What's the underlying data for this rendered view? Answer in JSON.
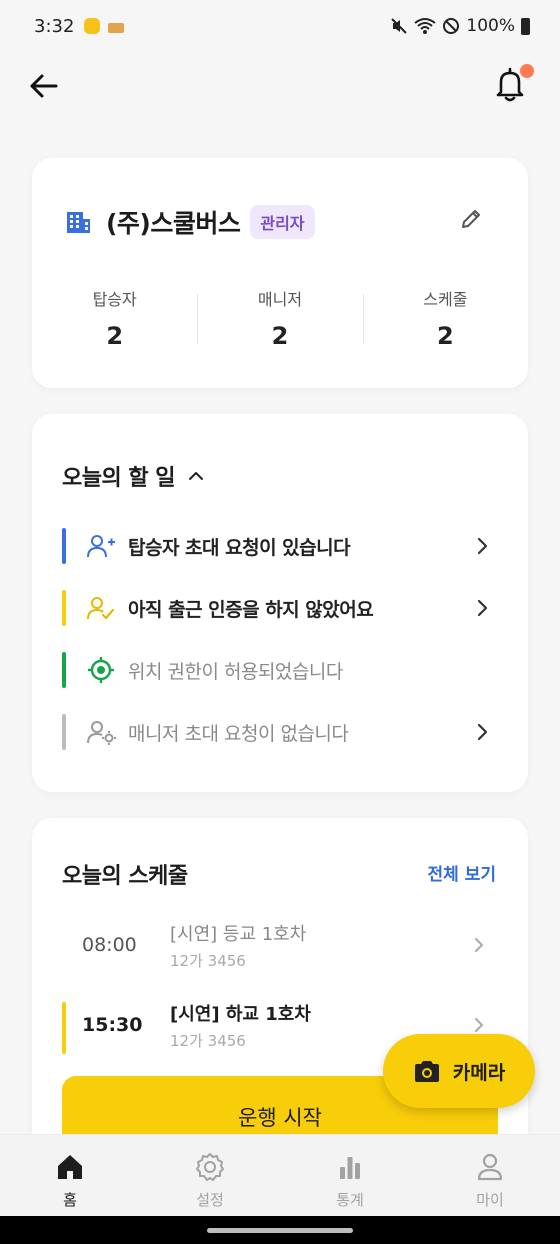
{
  "status_bar": {
    "time": "3:32",
    "battery": "100%"
  },
  "colors": {
    "accent": "#f8cd0a",
    "link": "#2f6bdb",
    "badge_bg": "#efe7fb",
    "badge_text": "#7a4bc9",
    "notification_dot": "#ff7a52"
  },
  "company": {
    "name": "(주)스쿨버스",
    "role_badge": "관리자",
    "stats": [
      {
        "label": "탑승자",
        "value": "2"
      },
      {
        "label": "매니저",
        "value": "2"
      },
      {
        "label": "스케줄",
        "value": "2"
      }
    ]
  },
  "todo": {
    "title": "오늘의 할 일",
    "items": [
      {
        "text": "탑승자 초대 요청이 있습니다",
        "icon": "person-add-icon",
        "bar_color": "#2f6bdb",
        "has_arrow": true
      },
      {
        "text": "아직 출근 인증을 하지 않았어요",
        "icon": "person-check-icon",
        "bar_color": "#f8cd0a",
        "has_arrow": true
      },
      {
        "text": "위치 권한이 허용되었습니다",
        "icon": "location-target-icon",
        "bar_color": "#16a34a",
        "has_arrow": false
      },
      {
        "text": "매니저 초대 요청이 없습니다",
        "icon": "person-gear-icon",
        "bar_color": "#bdbdbd",
        "has_arrow": true
      }
    ]
  },
  "schedule": {
    "title": "오늘의 스케줄",
    "view_all": "전체 보기",
    "items": [
      {
        "time": "08:00",
        "title": "[시연] 등교 1호차",
        "plate": "12가 3456"
      },
      {
        "time": "15:30",
        "title": "[시연] 하교 1호차",
        "plate": "12가 3456"
      }
    ],
    "start_button": "운행 시작"
  },
  "fab": {
    "label": "카메라"
  },
  "bottom_nav": [
    {
      "label": "홈",
      "icon": "home-icon"
    },
    {
      "label": "설정",
      "icon": "gear-icon"
    },
    {
      "label": "통계",
      "icon": "bar-chart-icon"
    },
    {
      "label": "마이",
      "icon": "person-icon"
    }
  ]
}
